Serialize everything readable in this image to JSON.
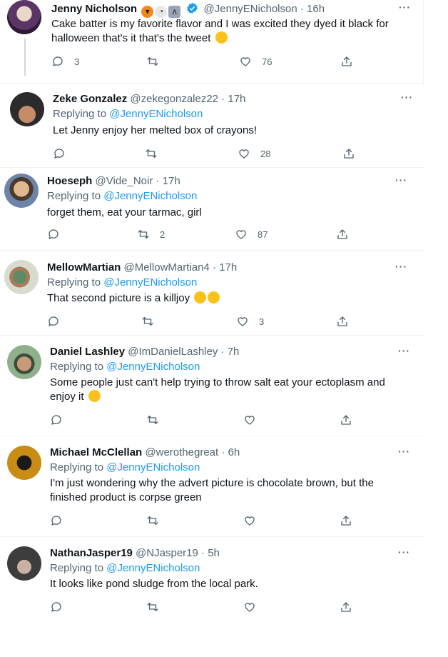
{
  "tweets": [
    {
      "name": "Jenny Nicholson",
      "handle": "@JennyENicholson",
      "time": "16h",
      "replying": "",
      "mention": "",
      "text": "Cake batter is my favorite flavor and I was excited they dyed it black for halloween that's it that's the tweet",
      "replies": "3",
      "retweets": "",
      "likes": "76",
      "avatar_color": "#7a4a8a"
    },
    {
      "name": "Zeke Gonzalez",
      "handle": "@zekegonzalez22",
      "time": "17h",
      "replying": "Replying to",
      "mention": "@JennyENicholson",
      "text": "Let Jenny enjoy her melted box of crayons!",
      "replies": "",
      "retweets": "",
      "likes": "28",
      "avatar_color": "#3a3a3a"
    },
    {
      "name": "Hoeseph",
      "handle": "@Vide_Noir",
      "time": "17h",
      "replying": "Replying to",
      "mention": "@JennyENicholson",
      "text": "forget them, eat your tarmac, girl",
      "replies": "",
      "retweets": "2",
      "likes": "87",
      "avatar_color": "#5b6f8a"
    },
    {
      "name": "MellowMartian",
      "handle": "@MellowMartian4",
      "time": "17h",
      "replying": "Replying to",
      "mention": "@JennyENicholson",
      "text": "That second picture is a killjoy",
      "replies": "",
      "retweets": "",
      "likes": "3",
      "avatar_color": "#8aa47a"
    },
    {
      "name": "Daniel Lashley",
      "handle": "@ImDanielLashley",
      "time": "7h",
      "replying": "Replying to",
      "mention": "@JennyENicholson",
      "text": "Some people just can't help trying to throw salt eat your ectoplasm and enjoy it",
      "replies": "",
      "retweets": "",
      "likes": "",
      "avatar_color": "#6a7f66"
    },
    {
      "name": "Michael McClellan",
      "handle": "@werothegreat",
      "time": "6h",
      "replying": "Replying to",
      "mention": "@JennyENicholson",
      "text": "I'm just wondering why the advert picture is chocolate brown, but the finished product is corpse green",
      "replies": "",
      "retweets": "",
      "likes": "",
      "avatar_color": "#d99a1e"
    },
    {
      "name": "NathanJasper19",
      "handle": "@NJasper19",
      "time": "5h",
      "replying": "Replying to",
      "mention": "@JennyENicholson",
      "text": "It looks like pond sludge from the local park.",
      "replies": "",
      "retweets": "",
      "likes": "",
      "avatar_color": "#4a4a4a"
    }
  ],
  "icons": [
    "reply-icon",
    "retweet-icon",
    "like-icon",
    "share-icon",
    "more-icon",
    "verified-icon"
  ],
  "colors": {
    "link": "#1d9bf0",
    "muted": "#536471",
    "text": "#0f1419",
    "divider": "#eff3f4"
  }
}
